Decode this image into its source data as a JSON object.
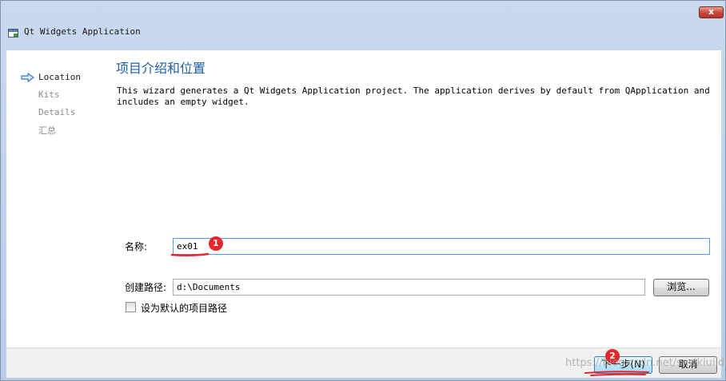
{
  "window": {
    "title": "Qt Widgets Application",
    "close_glyph": "x"
  },
  "nav": {
    "items": [
      {
        "label": "Location",
        "current": true
      },
      {
        "label": "Kits",
        "current": false
      },
      {
        "label": "Details",
        "current": false
      },
      {
        "label": "汇总",
        "current": false
      }
    ],
    "current_icon": "right-arrow-icon"
  },
  "page": {
    "title": "项目介绍和位置",
    "description": "This wizard generates a Qt Widgets Application project. The application derives by default from QApplication and includes an empty widget."
  },
  "form": {
    "name_label": "名称:",
    "name_value": "ex01",
    "path_label": "创建路径:",
    "path_value": "d:\\Documents",
    "browse_label": "浏览...",
    "default_path_label": "设为默认的项目路径",
    "default_path_checked": false
  },
  "footer": {
    "next_label": "下一步(N)",
    "cancel_label": "取消"
  },
  "annotations": {
    "marker_1": "1",
    "marker_2": "2",
    "color": "#e8252b"
  },
  "watermark": "https://blog.csdn.net/snsikiuiido"
}
